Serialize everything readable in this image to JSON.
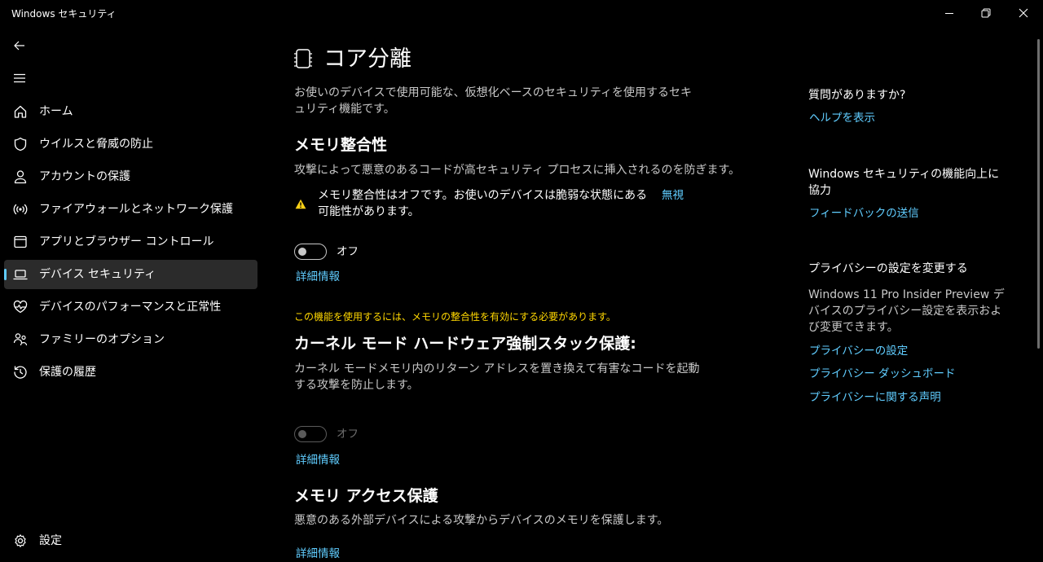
{
  "window": {
    "title": "Windows セキュリティ"
  },
  "nav": {
    "items": [
      {
        "label": "ホーム",
        "icon": "home-icon"
      },
      {
        "label": "ウイルスと脅威の防止",
        "icon": "shield-icon"
      },
      {
        "label": "アカウントの保護",
        "icon": "person-icon"
      },
      {
        "label": "ファイアウォールとネットワーク保護",
        "icon": "wireless-signal-icon"
      },
      {
        "label": "アプリとブラウザー コントロール",
        "icon": "app-window-icon"
      },
      {
        "label": "デバイス セキュリティ",
        "icon": "laptop-icon",
        "selected": true
      },
      {
        "label": "デバイスのパフォーマンスと正常性",
        "icon": "heart-pulse-icon"
      },
      {
        "label": "ファミリーのオプション",
        "icon": "family-icon"
      },
      {
        "label": "保護の履歴",
        "icon": "history-icon"
      }
    ],
    "settings_label": "設定"
  },
  "main": {
    "title": "コア分離",
    "description": "お使いのデバイスで使用可能な、仮想化ベースのセキュリティを使用するセキュリティ機能です。",
    "memory_integrity": {
      "heading": "メモリ整合性",
      "description": "攻撃によって悪意のあるコードが高セキュリティ プロセスに挿入されるのを防ぎます。",
      "warning": "メモリ整合性はオフです。お使いのデバイスは脆弱な状態にある可能性があります。",
      "dismiss": "無視",
      "toggle_state": "オフ",
      "learn_more": "詳細情報"
    },
    "kernel_stack": {
      "notice": "この機能を使用するには、メモリの整合性を有効にする必要があります。",
      "heading": "カーネル モード ハードウェア強制スタック保護:",
      "description": "カーネル モードメモリ内のリターン アドレスを置き換えて有害なコードを起動する攻撃を防止します。",
      "toggle_state": "オフ",
      "learn_more": "詳細情報"
    },
    "memory_access": {
      "heading": "メモリ アクセス保護",
      "description": "悪意のある外部デバイスによる攻撃からデバイスのメモリを保護します。",
      "learn_more": "詳細情報"
    }
  },
  "side": {
    "question_heading": "質問がありますか?",
    "help_link": "ヘルプを表示",
    "improve_heading": "Windows セキュリティの機能向上に協力",
    "feedback_link": "フィードバックの送信",
    "privacy_heading": "プライバシーの設定を変更する",
    "privacy_text": "Windows 11 Pro Insider Preview デバイスのプライバシー設定を表示および変更できます。",
    "privacy_links": [
      "プライバシーの設定",
      "プライバシー ダッシュボード",
      "プライバシーに関する声明"
    ]
  },
  "colors": {
    "accent": "#60cdff",
    "warning_icon": "#fcd116",
    "notice_text": "#ffd700",
    "selected_bg": "#2b2b2b"
  }
}
